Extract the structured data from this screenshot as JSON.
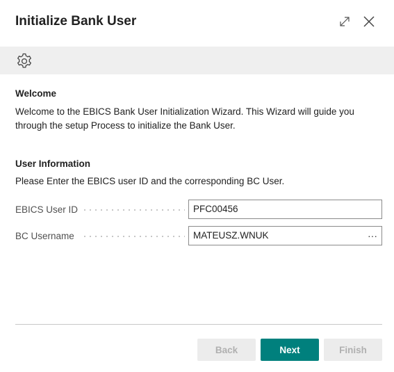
{
  "dialog": {
    "title": "Initialize Bank User"
  },
  "welcome": {
    "heading": "Welcome",
    "line1": "Welcome to the EBICS Bank User Initialization Wizard. This Wizard will guide you",
    "line2": "through the setup Process to initialize the Bank User."
  },
  "user_info": {
    "heading": "User Information",
    "description": "Please Enter the EBICS user ID and the corresponding BC User."
  },
  "fields": {
    "ebics_user_id": {
      "label": "EBICS User ID",
      "value": "PFC00456"
    },
    "bc_username": {
      "label": "BC Username",
      "value": "MATEUSZ.WNUK",
      "lookup": "···"
    }
  },
  "buttons": {
    "back": "Back",
    "next": "Next",
    "finish": "Finish"
  },
  "colors": {
    "primary": "#00807d",
    "toolbar_bg": "#efefef",
    "disabled_bg": "#ececec",
    "disabled_text": "#b0b0b0"
  },
  "icons": {
    "expand": "expand-icon",
    "close": "close-icon",
    "settings": "gear-icon"
  }
}
